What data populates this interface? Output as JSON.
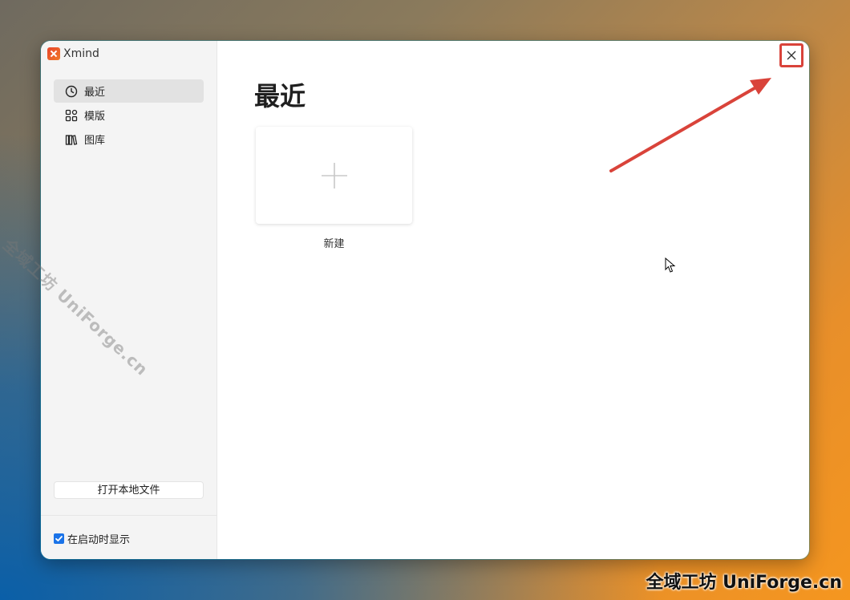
{
  "app": {
    "title": "Xmind"
  },
  "sidebar": {
    "items": [
      {
        "label": "最近",
        "icon": "clock-icon",
        "active": true
      },
      {
        "label": "模版",
        "icon": "template-grid-icon",
        "active": false
      },
      {
        "label": "图库",
        "icon": "library-icon",
        "active": false
      }
    ],
    "open_file_label": "打开本地文件",
    "startup_label": "在启动时显示",
    "startup_checked": true
  },
  "main": {
    "title": "最近",
    "new_label": "新建"
  },
  "watermark": {
    "diagonal": "全域工坊 UniForge.cn",
    "corner": "全域工坊 UniForge.cn"
  },
  "colors": {
    "highlight": "#d9433a",
    "checkbox": "#1a73e8",
    "logo": "#e8452b"
  }
}
